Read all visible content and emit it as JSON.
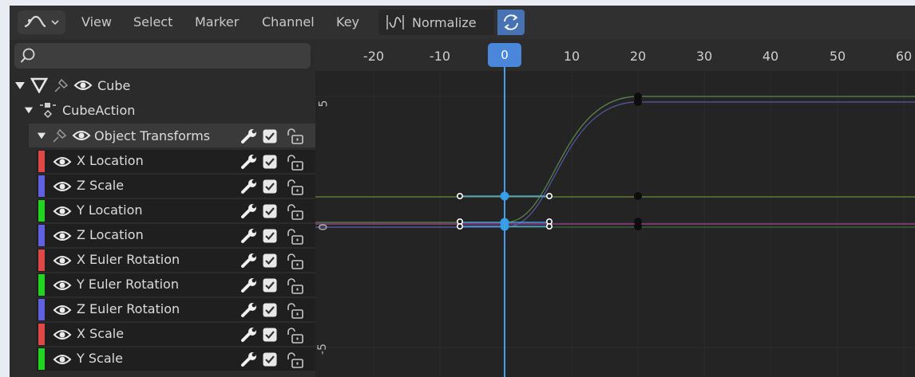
{
  "header": {
    "menus": [
      "View",
      "Select",
      "Marker",
      "Channel",
      "Key"
    ],
    "normalize_label": "Normalize"
  },
  "timeline": {
    "tick_labels": [
      "-20",
      "-10",
      "0",
      "10",
      "20",
      "30",
      "40",
      "50",
      "60"
    ],
    "current_frame": "0",
    "y_labels": [
      "5",
      "0",
      "-5"
    ]
  },
  "tree": {
    "object": "Cube",
    "action": "CubeAction",
    "group": "Object Transforms",
    "channels": [
      {
        "label": "X Location",
        "color": "#e04747"
      },
      {
        "label": "Z Scale",
        "color": "#6060e0"
      },
      {
        "label": "Y Location",
        "color": "#22d322"
      },
      {
        "label": "Z Location",
        "color": "#6060e0"
      },
      {
        "label": "X Euler Rotation",
        "color": "#e04747"
      },
      {
        "label": "Y Euler Rotation",
        "color": "#22d322"
      },
      {
        "label": "Z Euler Rotation",
        "color": "#6060e0"
      },
      {
        "label": "X Scale",
        "color": "#e04747"
      },
      {
        "label": "Y Scale",
        "color": "#22d322"
      }
    ]
  },
  "colors": {
    "accent": "#4a86d9",
    "playhead": "#4a9be8",
    "selected_key": "#2f9fe8"
  }
}
